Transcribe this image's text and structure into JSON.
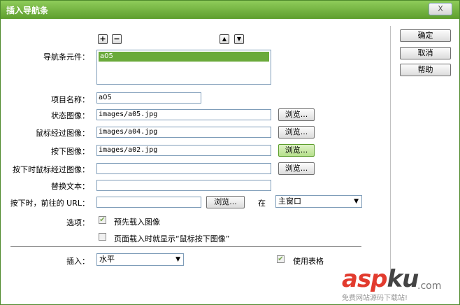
{
  "window": {
    "title": "插入导航条",
    "close_label": "X"
  },
  "buttons": {
    "ok": "确定",
    "cancel": "取消",
    "help": "帮助"
  },
  "list_controls": {
    "add": "+",
    "remove": "−",
    "up": "▲",
    "down": "▼"
  },
  "nav_elements": {
    "label": "导航条元件：",
    "items": [
      "a05"
    ]
  },
  "item_name": {
    "label": "项目名称：",
    "value": "a05"
  },
  "status_image": {
    "label": "状态图像：",
    "value": "images/a05.jpg"
  },
  "rollover_image": {
    "label": "鼠标经过图像：",
    "value": "images/a04.jpg"
  },
  "down_image": {
    "label": "按下图像：",
    "value": "images/a02.jpg"
  },
  "down_rollover_image": {
    "label": "按下时鼠标经过图像：",
    "value": ""
  },
  "alt_text": {
    "label": "替换文本：",
    "value": ""
  },
  "url": {
    "label": "按下时，前往的 URL：",
    "value": "",
    "in_label": "在",
    "target": "主窗口"
  },
  "browse_label": "浏览...",
  "options": {
    "label": "选项：",
    "preload": "预先载入图像",
    "preload_checked": true,
    "show_down": "页面载入时就显示“鼠标按下图像”",
    "show_down_checked": false
  },
  "insert": {
    "label": "插入：",
    "value": "水平"
  },
  "use_table": {
    "label": "使用表格",
    "checked": true
  },
  "watermark": {
    "main": "asp",
    "suffix": "ku",
    "domain": ".com",
    "tagline": "免费网站源码下载站!"
  },
  "colors": {
    "title_bar": "#6aaa3a",
    "selection": "#6aaa3a",
    "watermark": "#e23b2e"
  }
}
